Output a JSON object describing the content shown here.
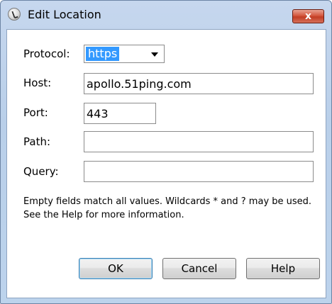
{
  "window": {
    "title": "Edit Location",
    "close_label": "x"
  },
  "form": {
    "protocol": {
      "label": "Protocol:",
      "value": "https"
    },
    "host": {
      "label": "Host:",
      "value": "apollo.51ping.com"
    },
    "port": {
      "label": "Port:",
      "value": "443"
    },
    "path": {
      "label": "Path:",
      "value": ""
    },
    "query": {
      "label": "Query:",
      "value": ""
    }
  },
  "help_text": "Empty fields match all values. Wildcards * and ? may be used. See the Help for more information.",
  "buttons": {
    "ok": "OK",
    "cancel": "Cancel",
    "help": "Help"
  },
  "colors": {
    "selection": "#3399ff",
    "titlebar": "#c6d7ee",
    "close_button": "#c23d24"
  }
}
